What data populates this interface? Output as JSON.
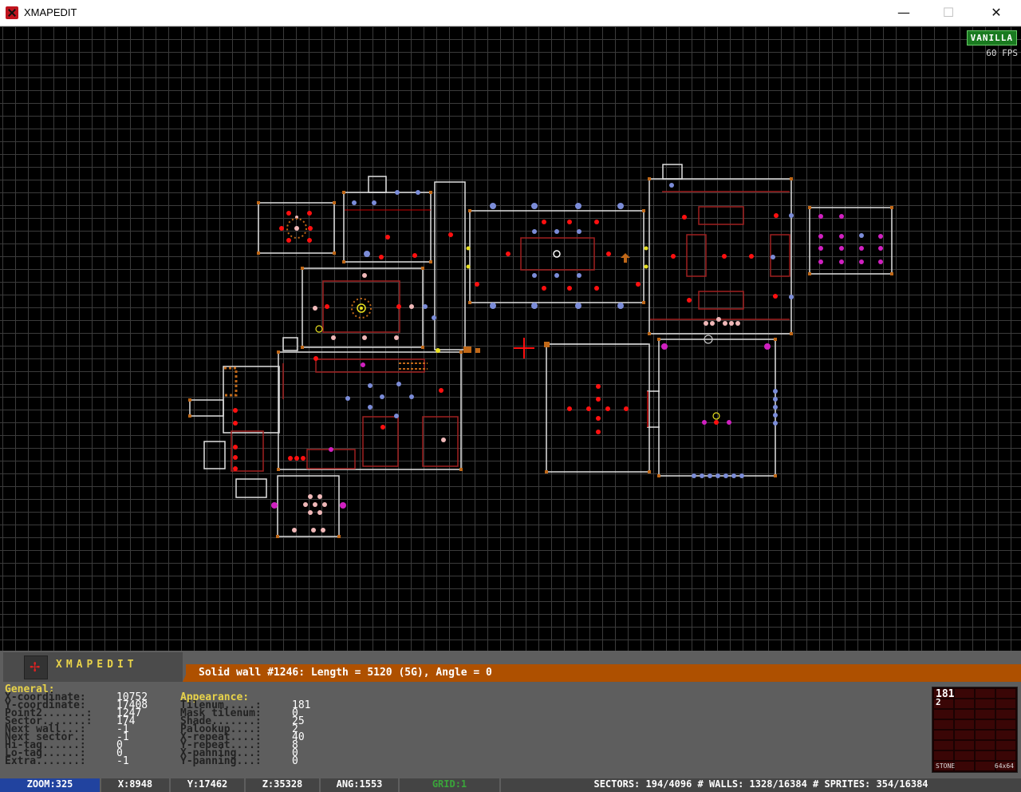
{
  "window": {
    "title": "XMAPEDIT",
    "minimize": "—",
    "maximize": "☐",
    "close": "✕"
  },
  "map": {
    "badge": "VANILLA",
    "fps": "60 FPS"
  },
  "panel": {
    "logo": "XMAPEDIT",
    "status": "Solid wall #1246: Length = 5120 (5G), Angle = 0",
    "general": {
      "title": "General:",
      "rows": [
        {
          "k": "X-coordinate:",
          "v": "10752"
        },
        {
          "k": "Y-coordinate:",
          "v": "17408"
        },
        {
          "k": "Point2.......:",
          "v": "1247"
        },
        {
          "k": "Sector.......:",
          "v": "174"
        },
        {
          "k": "Next wall...:",
          "v": "-1"
        },
        {
          "k": "Next sector.:",
          "v": "-1"
        },
        {
          "k": "Hi-tag......:",
          "v": "0"
        },
        {
          "k": "Lo-tag......:",
          "v": "0"
        },
        {
          "k": "Extra.......:",
          "v": "-1"
        }
      ]
    },
    "appearance": {
      "title": "Appearance:",
      "rows": [
        {
          "k": "Tilenum.....:",
          "v": "181"
        },
        {
          "k": "Mask tilenum:",
          "v": "0"
        },
        {
          "k": "Shade.......:",
          "v": "25"
        },
        {
          "k": "Palookup....:",
          "v": "2"
        },
        {
          "k": "X-repeat....:",
          "v": "40"
        },
        {
          "k": "Y-repeat....:",
          "v": "8"
        },
        {
          "k": "X-panning...:",
          "v": "0"
        },
        {
          "k": "Y-panning...:",
          "v": "0"
        }
      ]
    },
    "texture": {
      "tile": "181",
      "pal": "2",
      "name": "STONE",
      "size": "64x64"
    }
  },
  "bottom": {
    "zoom": "ZOOM:325",
    "x": "X:8948",
    "y": "Y:17462",
    "z": "Z:35328",
    "ang": "ANG:1553",
    "grid": "GRID:1",
    "stats": "SECTORS: 194/4096 # WALLS: 1328/16384 # SPRITES: 354/16384"
  },
  "colors": {
    "wall": "#e0e0e0",
    "red_wall": "#c80000",
    "sector_line": "#a02020",
    "vertex": "#c06818",
    "sprite_red": "#ff1010",
    "sprite_blue": "#7b8cd8",
    "sprite_pink": "#f0b8b8",
    "sprite_magenta": "#d020c0",
    "status_bar": "#ae5000",
    "badge": "#1a7a20"
  }
}
